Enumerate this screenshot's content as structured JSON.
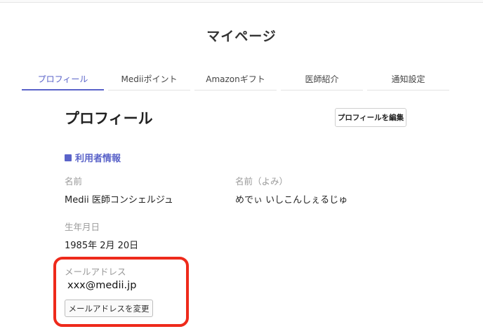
{
  "header": {
    "title": "マイページ"
  },
  "tabs": [
    {
      "label": "プロフィール",
      "active": true
    },
    {
      "label": "Mediiポイント",
      "active": false
    },
    {
      "label": "Amazonギフト",
      "active": false
    },
    {
      "label": "医師紹介",
      "active": false
    },
    {
      "label": "通知設定",
      "active": false
    }
  ],
  "profile": {
    "title": "プロフィール",
    "edit_label": "プロフィールを編集",
    "user_info_heading": "利用者情報",
    "name_label": "名前",
    "name_value": "Medii 医師コンシェルジュ",
    "name_kana_label": "名前（よみ）",
    "name_kana_value": "めでぃ いしこんしぇるじゅ",
    "birthdate_label": "生年月日",
    "birthdate_value": "1985年 2月 20日",
    "email_label": "メールアドレス",
    "email_value": "xxx@medii.jp",
    "change_email_label": "メールアドレスを変更"
  },
  "colors": {
    "accent": "#5a63c9",
    "highlight": "#ee2a1b"
  }
}
